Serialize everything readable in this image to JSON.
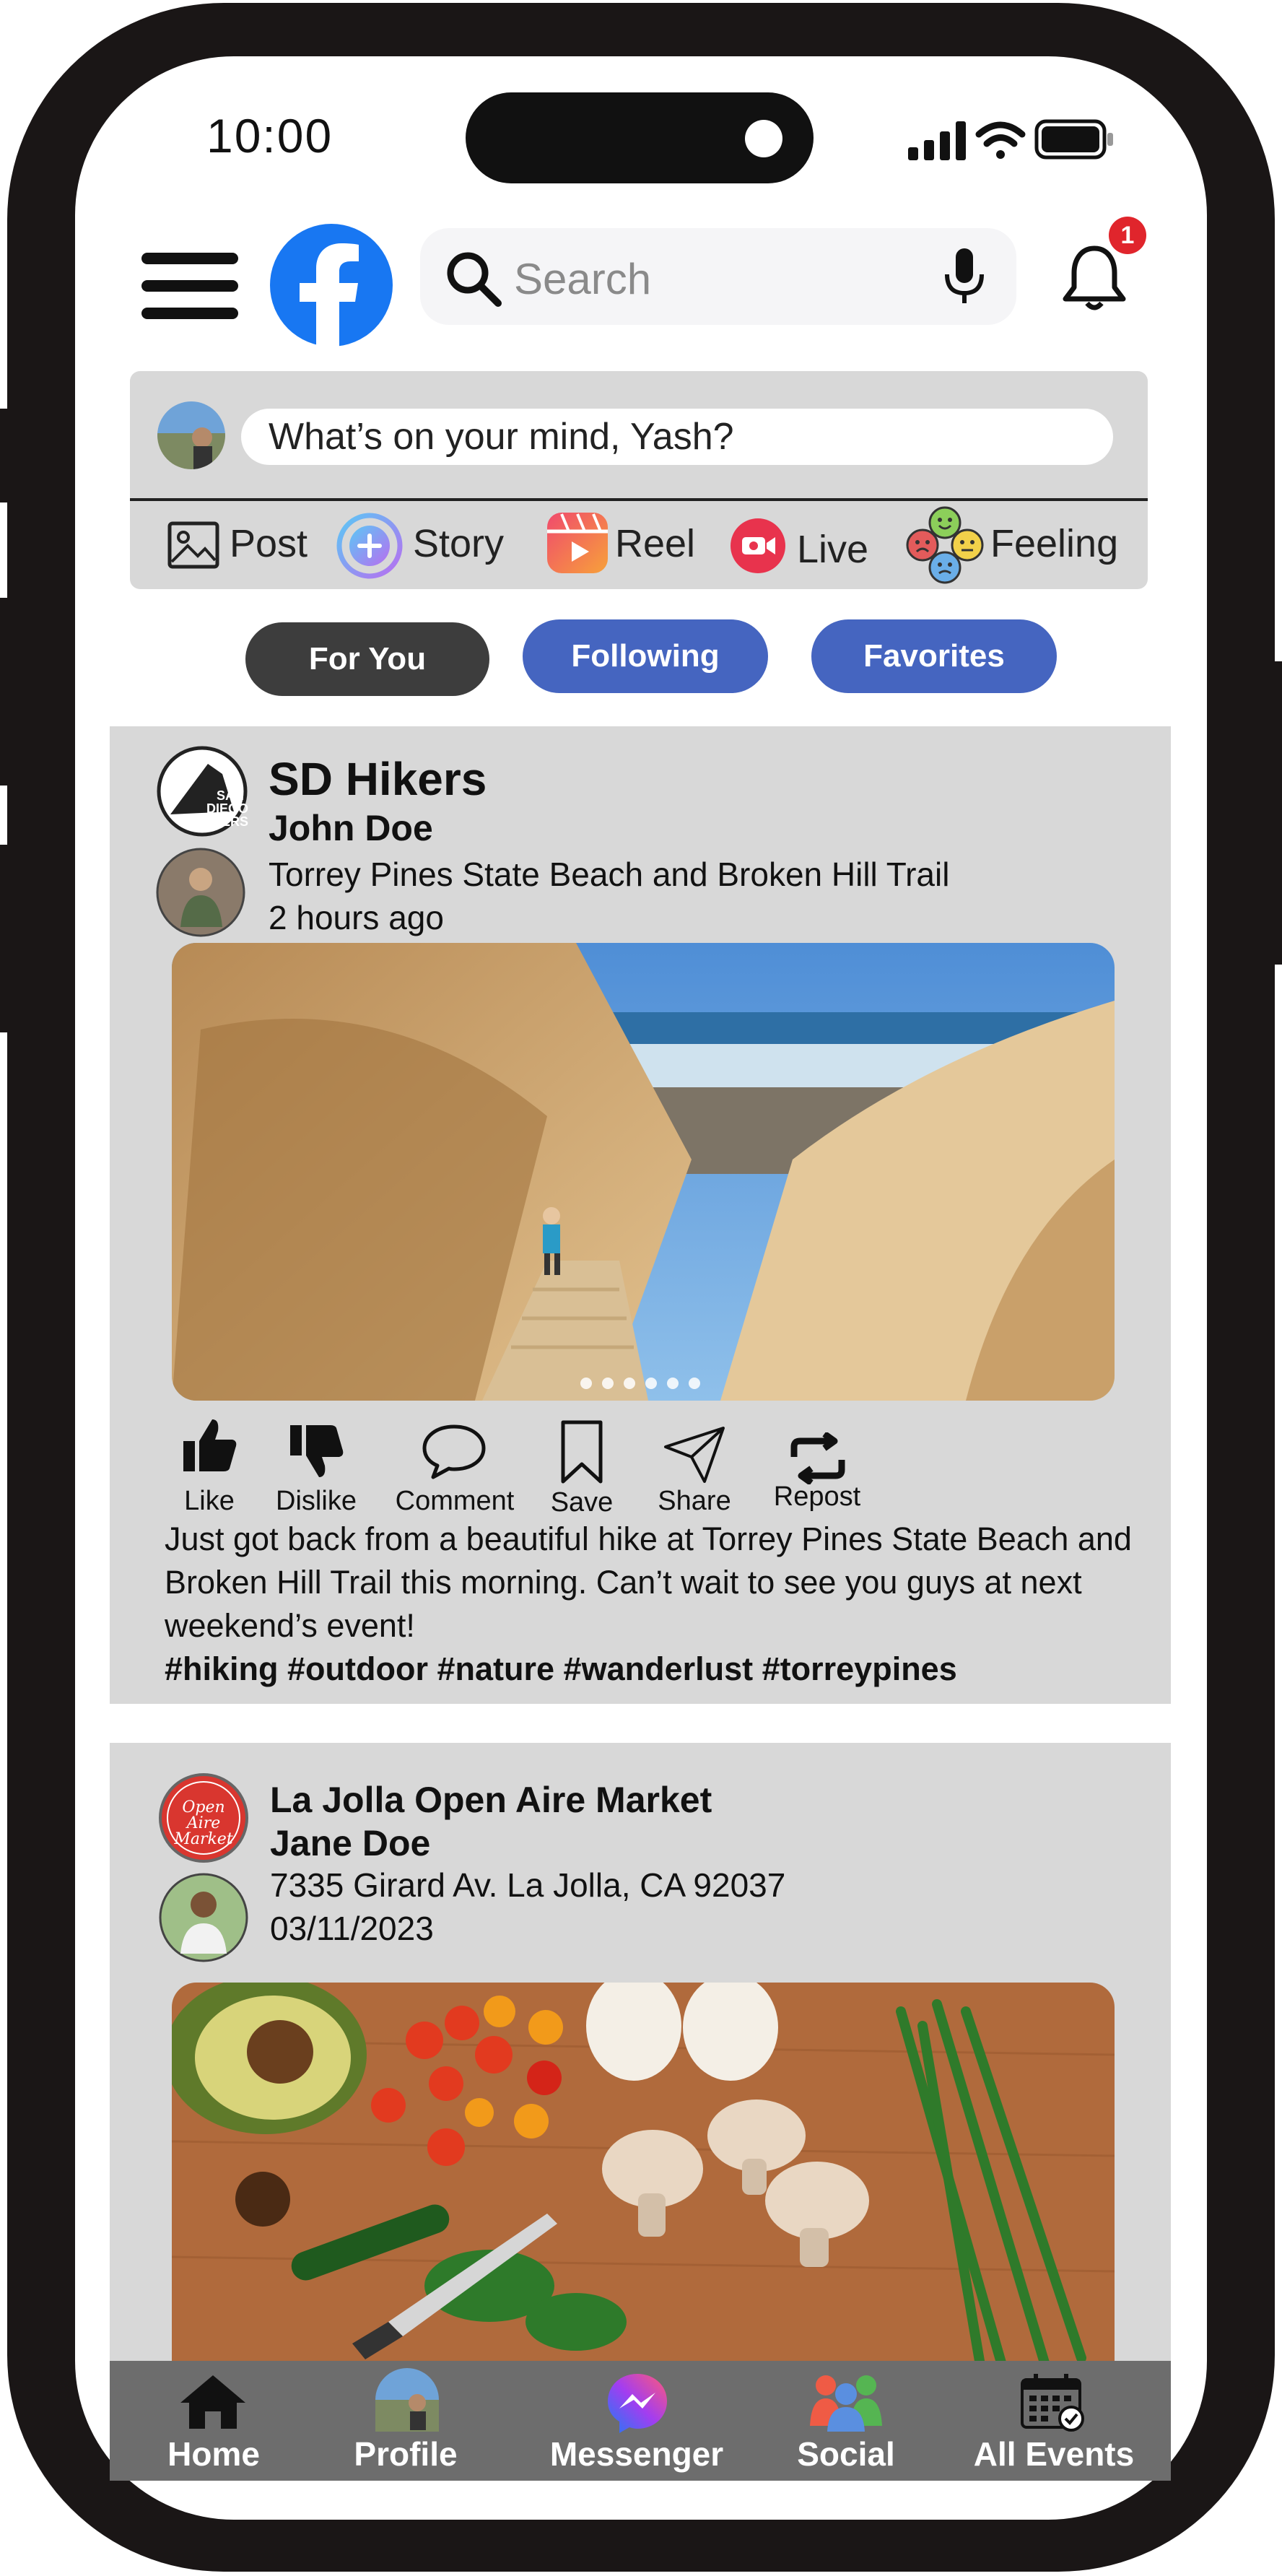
{
  "status_bar": {
    "time": "10:00"
  },
  "header": {
    "search_placeholder": "Search",
    "notification_count": "1",
    "brand_color": "#1877F2"
  },
  "composer": {
    "prompt": "What’s on your mind, Yash?",
    "options": [
      "Post",
      "Story",
      "Reel",
      "Live",
      "Feeling"
    ]
  },
  "feed_tabs": [
    {
      "label": "For You",
      "color": "#3d3d3d",
      "active": true
    },
    {
      "label": "Following",
      "color": "#4565c0",
      "active": false
    },
    {
      "label": "Favorites",
      "color": "#4565c0",
      "active": false
    }
  ],
  "posts": [
    {
      "group": "SD Hikers",
      "group_logo_text": "SAN DIEGO HIKERS",
      "author": "John Doe",
      "location": "Torrey Pines State Beach and Broken Hill Trail",
      "time": "2 hours ago",
      "actions": [
        "Like",
        "Dislike",
        "Comment",
        "Save",
        "Share",
        "Repost"
      ],
      "body": "Just got back from a beautiful hike at Torrey Pines State Beach and Broken Hill Trail this morning. Can’t wait to see you guys at next weekend’s event!",
      "hashtags": "#hiking #outdoor #nature #wanderlust #torreypines"
    },
    {
      "group": "La Jolla Open Aire Market",
      "group_logo_text": "Open Aire Market",
      "author": "Jane Doe",
      "location": "7335 Girard Av. La Jolla, CA 92037",
      "time": "03/11/2023"
    }
  ],
  "bottom_nav": [
    "Home",
    "Profile",
    "Messenger",
    "Social",
    "All Events"
  ]
}
